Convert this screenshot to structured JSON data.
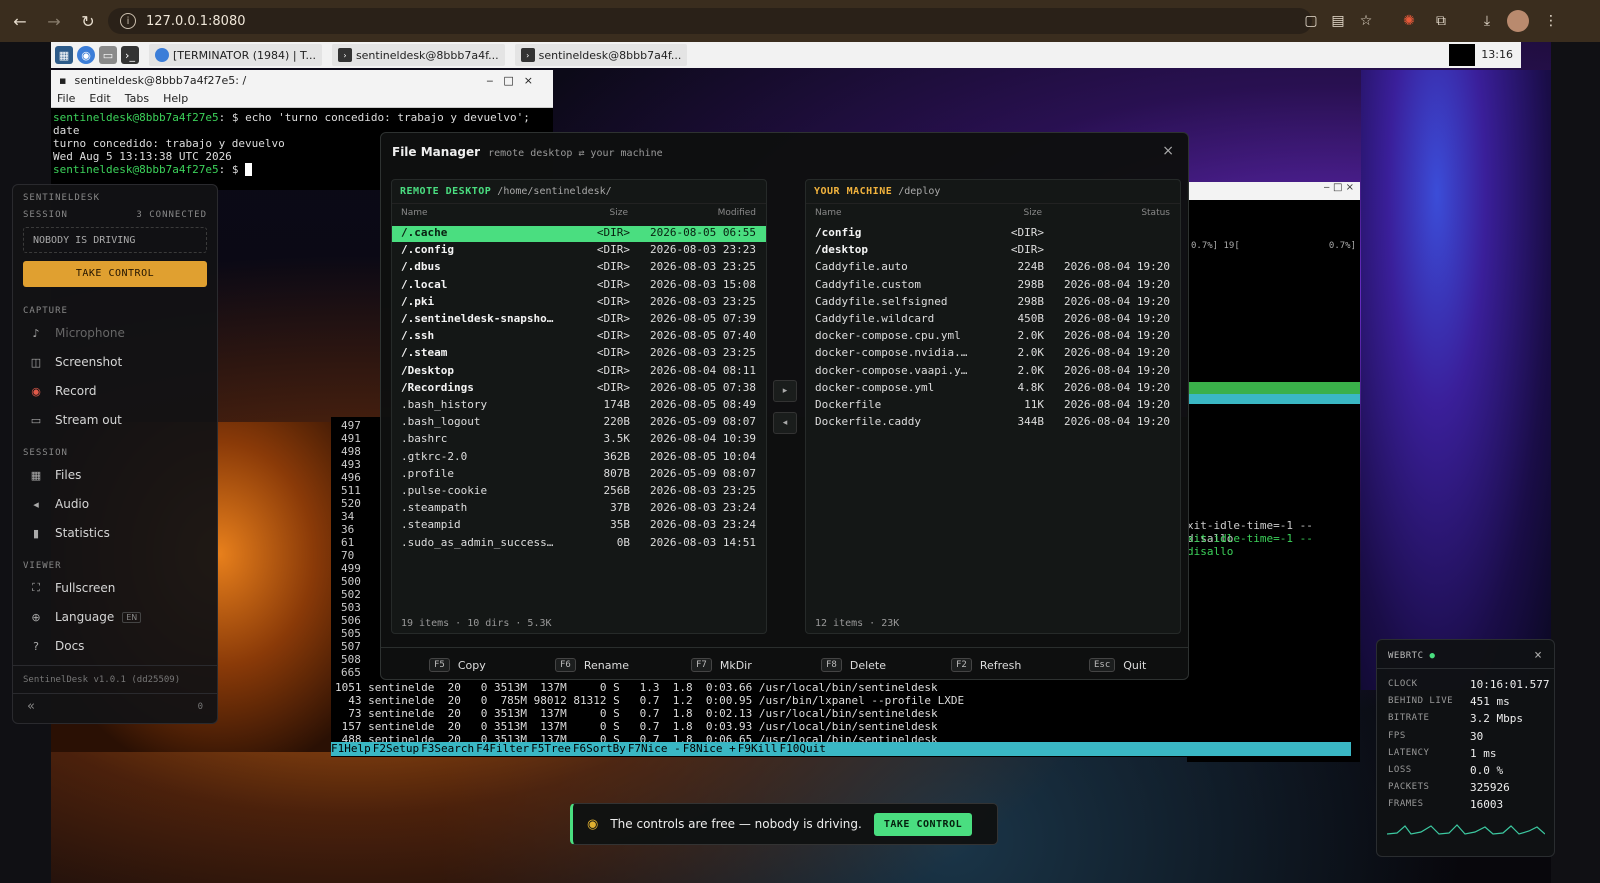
{
  "browser": {
    "url": "127.0.0.1:8080"
  },
  "taskbar": {
    "tasks": [
      "[TERMINATOR (1984) | T...",
      "sentineldesk@8bbb7a4f...",
      "sentineldesk@8bbb7a4f..."
    ],
    "clock": "13:16"
  },
  "terminal": {
    "title": "sentineldesk@8bbb7a4f27e5: /",
    "menu": [
      "File",
      "Edit",
      "Tabs",
      "Help"
    ],
    "lines": [
      {
        "prompt": "sentineldesk@8bbb7a4f27e5",
        "cmd": ": $ echo 'turno concedido: trabajo y devuelvo'; date"
      },
      {
        "text": "turno concedido: trabajo y devuelvo"
      },
      {
        "text": "Wed Aug  5 13:13:38 UTC 2026"
      },
      {
        "prompt": "sentineldesk@8bbb7a4f27e5",
        "cmd": ": $ "
      }
    ]
  },
  "sidebar": {
    "brand": "SENTINELDESK",
    "session_label": "SESSION",
    "connected": "3 CONNECTED",
    "driving": "NOBODY IS DRIVING",
    "take_control": "TAKE CONTROL",
    "capture_label": "CAPTURE",
    "capture_items": [
      "Microphone",
      "Screenshot",
      "Record",
      "Stream out"
    ],
    "session2_label": "SESSION",
    "session_items": [
      "Files",
      "Audio",
      "Statistics"
    ],
    "viewer_label": "VIEWER",
    "viewer_items": [
      "Fullscreen",
      "Language",
      "Docs"
    ],
    "language_badge": "EN",
    "version": "SentinelDesk v1.0.1 (dd25509)",
    "collapse": "«",
    "count": "0"
  },
  "file_manager": {
    "title": "File Manager",
    "subtitle": "remote desktop ⇄ your machine",
    "close": "×",
    "remote": {
      "label": "REMOTE DESKTOP",
      "path": "/home/sentineldesk/",
      "cols": [
        "Name",
        "Size",
        "Modified"
      ],
      "rows": [
        [
          "/.cache",
          "<DIR>",
          "2026-08-05 06:55"
        ],
        [
          "/.config",
          "<DIR>",
          "2026-08-03 23:23"
        ],
        [
          "/.dbus",
          "<DIR>",
          "2026-08-03 23:25"
        ],
        [
          "/.local",
          "<DIR>",
          "2026-08-03 15:08"
        ],
        [
          "/.pki",
          "<DIR>",
          "2026-08-03 23:25"
        ],
        [
          "/.sentineldesk-snapsho…",
          "<DIR>",
          "2026-08-05 07:39"
        ],
        [
          "/.ssh",
          "<DIR>",
          "2026-08-05 07:40"
        ],
        [
          "/.steam",
          "<DIR>",
          "2026-08-03 23:25"
        ],
        [
          "/Desktop",
          "<DIR>",
          "2026-08-04 08:11"
        ],
        [
          "/Recordings",
          "<DIR>",
          "2026-08-05 07:38"
        ],
        [
          ".bash_history",
          "174B",
          "2026-08-05 08:49"
        ],
        [
          ".bash_logout",
          "220B",
          "2026-05-09 08:07"
        ],
        [
          ".bashrc",
          "3.5K",
          "2026-08-04 10:39"
        ],
        [
          ".gtkrc-2.0",
          "362B",
          "2026-08-05 10:04"
        ],
        [
          ".profile",
          "807B",
          "2026-05-09 08:07"
        ],
        [
          ".pulse-cookie",
          "256B",
          "2026-08-03 23:25"
        ],
        [
          ".steampath",
          "37B",
          "2026-08-03 23:24"
        ],
        [
          ".steampid",
          "35B",
          "2026-08-03 23:24"
        ],
        [
          ".sudo_as_admin_success…",
          "0B",
          "2026-08-03 14:51"
        ]
      ],
      "footer": "19 items · 10 dirs · 5.3K"
    },
    "local": {
      "label": "YOUR MACHINE",
      "path": "/deploy",
      "cols": [
        "Name",
        "Size",
        "Status"
      ],
      "rows": [
        [
          "/config",
          "<DIR>",
          ""
        ],
        [
          "/desktop",
          "<DIR>",
          ""
        ],
        [
          "Caddyfile.auto",
          "224B",
          "2026-08-04 19:20"
        ],
        [
          "Caddyfile.custom",
          "298B",
          "2026-08-04 19:20"
        ],
        [
          "Caddyfile.selfsigned",
          "298B",
          "2026-08-04 19:20"
        ],
        [
          "Caddyfile.wildcard",
          "450B",
          "2026-08-04 19:20"
        ],
        [
          "docker-compose.cpu.yml",
          "2.0K",
          "2026-08-04 19:20"
        ],
        [
          "docker-compose.nvidia.…",
          "2.0K",
          "2026-08-04 19:20"
        ],
        [
          "docker-compose.vaapi.y…",
          "2.0K",
          "2026-08-04 19:20"
        ],
        [
          "docker-compose.yml",
          "4.8K",
          "2026-08-04 19:20"
        ],
        [
          "Dockerfile",
          "11K",
          "2026-08-04 19:20"
        ],
        [
          "Dockerfile.caddy",
          "344B",
          "2026-08-04 19:20"
        ]
      ],
      "footer": "12 items · 23K"
    },
    "arrows": [
      "▸",
      "◂"
    ],
    "fkeys": [
      {
        "key": "F5",
        "label": "Copy"
      },
      {
        "key": "F6",
        "label": "Rename"
      },
      {
        "key": "F7",
        "label": "MkDir"
      },
      {
        "key": "F8",
        "label": "Delete"
      },
      {
        "key": "F2",
        "label": "Refresh"
      },
      {
        "key": "Esc",
        "label": "Quit"
      }
    ]
  },
  "htop": {
    "pids_left": [
      "497",
      "491",
      "498",
      "493",
      "496",
      "511",
      "520",
      "34",
      "36",
      "61",
      "70",
      "499",
      "500",
      "502",
      "503",
      "506",
      "505",
      "507",
      "508",
      "665"
    ],
    "rows": [
      "1051 sentinelde  20   0 3513M  137M     0 S   1.3  1.8  0:03.66 /usr/local/bin/sentineldesk",
      "  43 sentinelde  20   0  785M 98012 81312 S   0.7  1.2  0:00.95 /usr/bin/lxpanel --profile LXDE",
      "  73 sentinelde  20   0 3513M  137M     0 S   0.7  1.8  0:02.13 /usr/local/bin/sentineldesk",
      " 157 sentinelde  20   0 3513M  137M     0 S   0.7  1.8  0:03.93 /usr/local/bin/sentineldesk",
      " 488 sentinelde  20   0 3513M  137M     0 S   0.7  1.8  0:06.65 /usr/local/bin/sentineldesk"
    ],
    "fbar": [
      "F1Help",
      "F2Setup",
      "F3Search",
      "F4Filter",
      "F5Tree",
      "F6SortBy",
      "F7Nice -",
      "F8Nice +",
      "F9Kill",
      "F10Quit"
    ],
    "right_frag": [
      "xit-idle-time=-1 --disallo",
      "xit-idle-time=-1 --disallo"
    ],
    "cpu_frag": [
      "0.7%] 19[",
      "0.7%]"
    ]
  },
  "webrtc": {
    "title": "WEBRTC",
    "close": "×",
    "stats": [
      {
        "k": "CLOCK",
        "v": "10:16:01.577"
      },
      {
        "k": "BEHIND LIVE",
        "v": "451 ms"
      },
      {
        "k": "BITRATE",
        "v": "3.2 Mbps"
      },
      {
        "k": "FPS",
        "v": "30"
      },
      {
        "k": "LATENCY",
        "v": "1 ms"
      },
      {
        "k": "LOSS",
        "v": "0.0 %"
      },
      {
        "k": "PACKETS",
        "v": "325926"
      },
      {
        "k": "FRAMES",
        "v": "16003"
      }
    ]
  },
  "banner": {
    "text": "The controls are free — nobody is driving.",
    "button": "TAKE CONTROL"
  }
}
